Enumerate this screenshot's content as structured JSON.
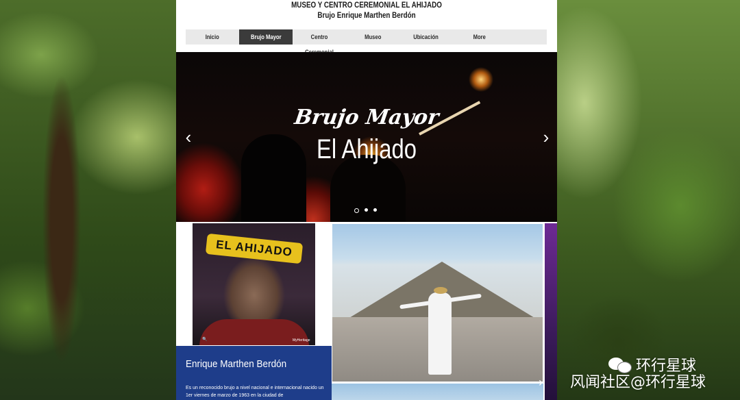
{
  "header": {
    "title_line1": "MUSEO Y CENTRO CEREMONIAL EL AHIJADO",
    "title_line2": "Brujo Enrique Marthen Berdón"
  },
  "nav": {
    "items": [
      {
        "label": "Inicio"
      },
      {
        "label": "Brujo Mayor",
        "active": true
      },
      {
        "label": "Centro Ceremonial"
      },
      {
        "label": "Museo"
      },
      {
        "label": "Ubicación"
      },
      {
        "label": "More"
      }
    ]
  },
  "hero": {
    "script_text": "Brujo Mayor",
    "title": "El Ahijado",
    "prev_icon": "chevron-left-icon",
    "next_icon": "chevron-right-icon",
    "prev_glyph": "‹",
    "next_glyph": "›",
    "slide_count": 3,
    "active_slide": 1
  },
  "portrait": {
    "headband_text": "EL AHIJADO",
    "badge_text": "MyHeritage"
  },
  "bio": {
    "name": "Enrique Marthen Berdón",
    "text": "Es un reconocido brujo a nivel nacional e internacional nacido un 1er viernes de marzo de 1963 en la ciudad de"
  },
  "gallery": {
    "next_glyph": "›"
  },
  "watermark": {
    "account": "环行星球",
    "line": "风闻社区@环行星球"
  },
  "colors": {
    "nav_active_bg": "#3b3b3b",
    "nav_bg": "#e9e9e9",
    "bio_bg": "#1e3d8a"
  }
}
